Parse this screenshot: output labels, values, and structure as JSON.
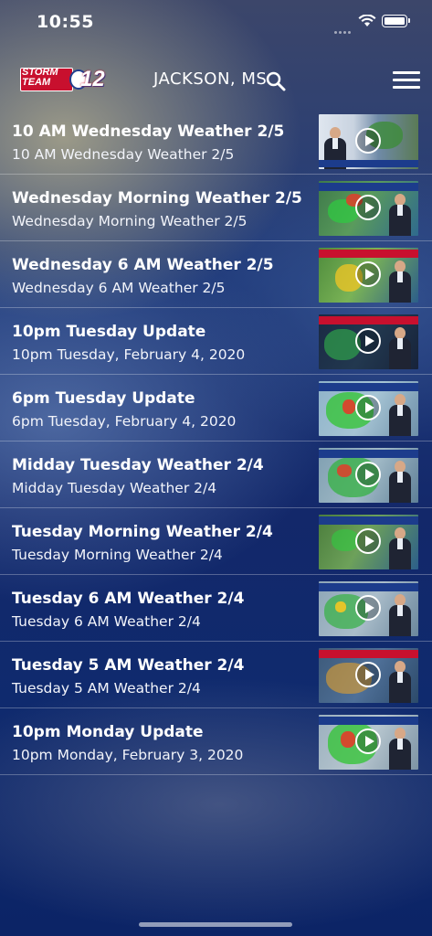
{
  "status_bar": {
    "time": "10:55"
  },
  "header": {
    "logo_line1": "STORM",
    "logo_line2": "TEAM",
    "logo_number": "12",
    "location": "JACKSON, MS"
  },
  "videos": [
    {
      "title": "10 AM Wednesday Weather 2/5",
      "subtitle": "10 AM Wednesday Weather 2/5"
    },
    {
      "title": "Wednesday Morning Weather 2/5",
      "subtitle": "Wednesday Morning Weather 2/5"
    },
    {
      "title": "Wednesday 6 AM Weather 2/5",
      "subtitle": "Wednesday 6 AM Weather 2/5"
    },
    {
      "title": "10pm Tuesday Update",
      "subtitle": "10pm Tuesday, February 4, 2020"
    },
    {
      "title": "6pm Tuesday Update",
      "subtitle": "6pm Tuesday, February 4, 2020"
    },
    {
      "title": "Midday Tuesday Weather 2/4",
      "subtitle": "Midday Tuesday Weather 2/4"
    },
    {
      "title": "Tuesday Morning Weather 2/4",
      "subtitle": "Tuesday Morning Weather 2/4"
    },
    {
      "title": "Tuesday 6 AM Weather 2/4",
      "subtitle": "Tuesday 6 AM Weather 2/4"
    },
    {
      "title": "Tuesday 5 AM Weather 2/4",
      "subtitle": "Tuesday 5 AM Weather 2/4"
    },
    {
      "title": "10pm Monday Update",
      "subtitle": "10pm Monday, February 3, 2020"
    }
  ],
  "colors": {
    "brand_red": "#c8102e",
    "brand_blue": "#1f3f8f"
  }
}
